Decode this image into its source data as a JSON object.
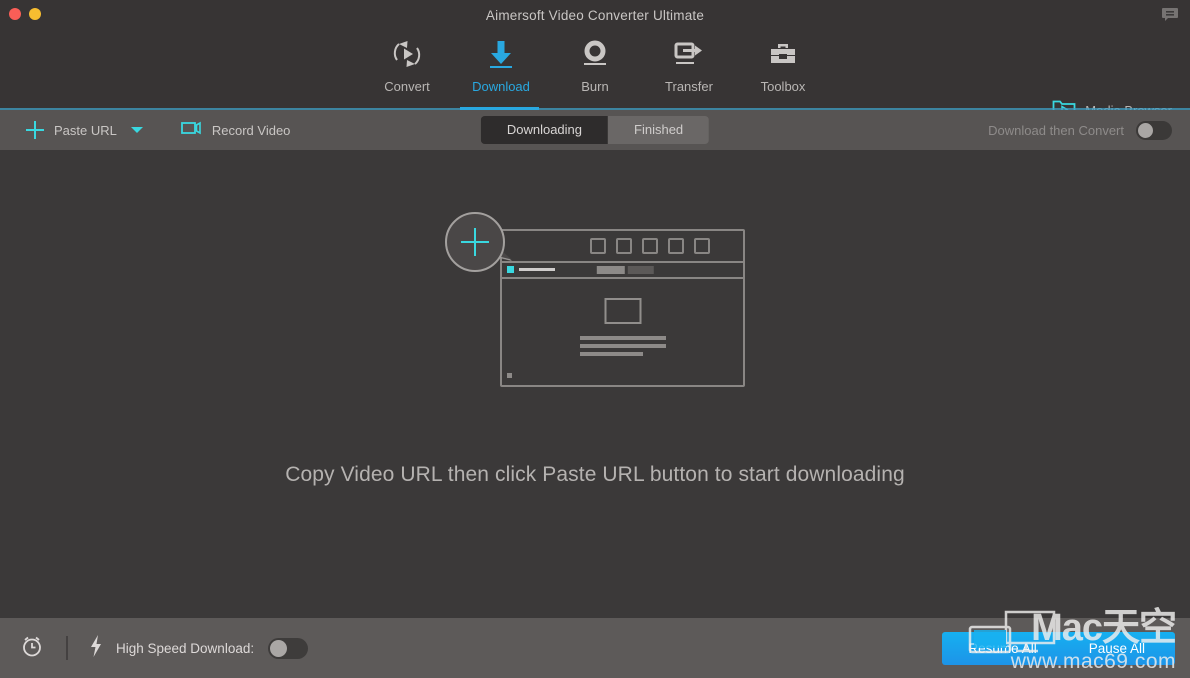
{
  "window": {
    "title": "Aimersoft Video Converter Ultimate",
    "traffic_lights": [
      "close",
      "minimize"
    ],
    "feedback_icon": "chat-bubble-icon"
  },
  "nav": {
    "items": [
      {
        "label": "Convert",
        "icon": "convert-circular-arrow-play-icon",
        "active": false
      },
      {
        "label": "Download",
        "icon": "download-arrow-icon",
        "active": true
      },
      {
        "label": "Burn",
        "icon": "burn-disc-icon",
        "active": false
      },
      {
        "label": "Transfer",
        "icon": "transfer-device-arrow-icon",
        "active": false
      },
      {
        "label": "Toolbox",
        "icon": "toolbox-briefcase-icon",
        "active": false
      }
    ],
    "media_browser": {
      "label": "Media Browser",
      "icon": "folder-play-icon"
    },
    "accent_color": "#29a8e0"
  },
  "toolbar": {
    "paste_url_label": "Paste URL",
    "paste_url_icon": "plus-icon",
    "paste_url_caret_icon": "chevron-down-icon",
    "record_video_label": "Record Video",
    "record_video_icon": "video-camera-icon",
    "tabs": [
      {
        "label": "Downloading",
        "active": true
      },
      {
        "label": "Finished",
        "active": false
      }
    ],
    "download_then_convert": {
      "label": "Download then Convert",
      "state": "off"
    },
    "cyan_color": "#39d8e0"
  },
  "main": {
    "hint_text": "Copy Video URL then click Paste URL button to start downloading",
    "illustration": {
      "name": "browser-window-placeholder",
      "badge_icon": "plus-badge-icon",
      "tab_squares": 5,
      "address_marker_color": "#39d8e0"
    }
  },
  "bottom": {
    "timer_icon": "alarm-clock-icon",
    "speed_icon": "lightning-bolt-icon",
    "high_speed_label": "High Speed Download:",
    "high_speed_state": "off",
    "resume_all_label": "Resume All",
    "pause_all_label": "Pause All",
    "button_color": "#16b0f0"
  },
  "watermark": {
    "brand": "Mac天空",
    "url": "www.mac69.com",
    "icon": "monitor-laptop-icon"
  }
}
